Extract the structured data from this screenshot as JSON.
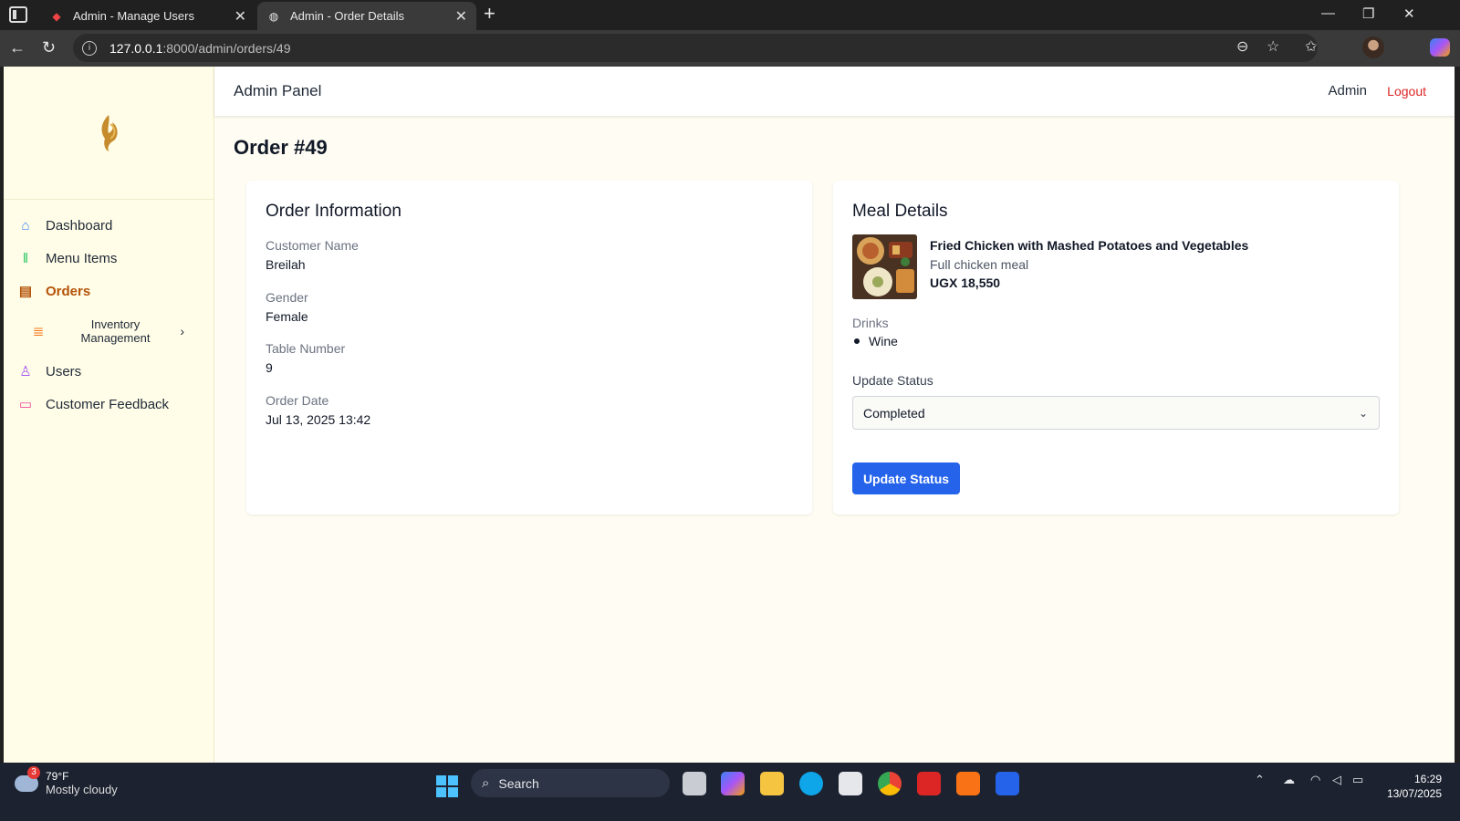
{
  "browser": {
    "tabs": [
      {
        "title": "Admin - Manage Users",
        "active": false
      },
      {
        "title": "Admin - Order Details",
        "active": true
      }
    ],
    "url_host": "127.0.0.1",
    "url_path": ":8000/admin/orders/49"
  },
  "sidebar": {
    "items": [
      {
        "label": "Dashboard",
        "icon": "home-icon",
        "color": "#3b82f6"
      },
      {
        "label": "Menu Items",
        "icon": "utensils-icon",
        "color": "#22c55e"
      },
      {
        "label": "Orders",
        "icon": "clipboard-icon",
        "color": "#b45309",
        "active": true
      },
      {
        "label": "Inventory Management",
        "icon": "layers-icon",
        "color": "#f97316"
      },
      {
        "label": "Users",
        "icon": "user-icon",
        "color": "#a855f7"
      },
      {
        "label": "Customer Feedback",
        "icon": "message-icon",
        "color": "#ec4899"
      }
    ]
  },
  "header": {
    "brand": "Admin Panel",
    "user": "Admin",
    "logout": "Logout"
  },
  "page": {
    "title": "Order #49"
  },
  "order_info": {
    "heading": "Order Information",
    "fields": [
      {
        "label": "Customer Name",
        "value": "Breilah"
      },
      {
        "label": "Gender",
        "value": "Female"
      },
      {
        "label": "Table Number",
        "value": "9"
      },
      {
        "label": "Order Date",
        "value": "Jul 13, 2025 13:42"
      }
    ]
  },
  "meal": {
    "heading": "Meal Details",
    "name": "Fried Chicken with Mashed Potatoes and Vegetables",
    "description": "Full chicken meal",
    "price": "UGX 18,550",
    "drinks_label": "Drinks",
    "drinks": [
      "Wine"
    ],
    "status_label": "Update Status",
    "status_value": "Completed",
    "update_button": "Update Status"
  },
  "taskbar": {
    "weather_badge": "3",
    "temperature": "79°F",
    "condition": "Mostly cloudy",
    "search": "Search",
    "time": "16:29",
    "date": "13/07/2025"
  },
  "colors": {
    "accent": "#2563eb",
    "sidebar_bg": "#fffde7",
    "page_bg": "#fffdf3",
    "logout": "#dc2626",
    "active_nav": "#b45309"
  }
}
